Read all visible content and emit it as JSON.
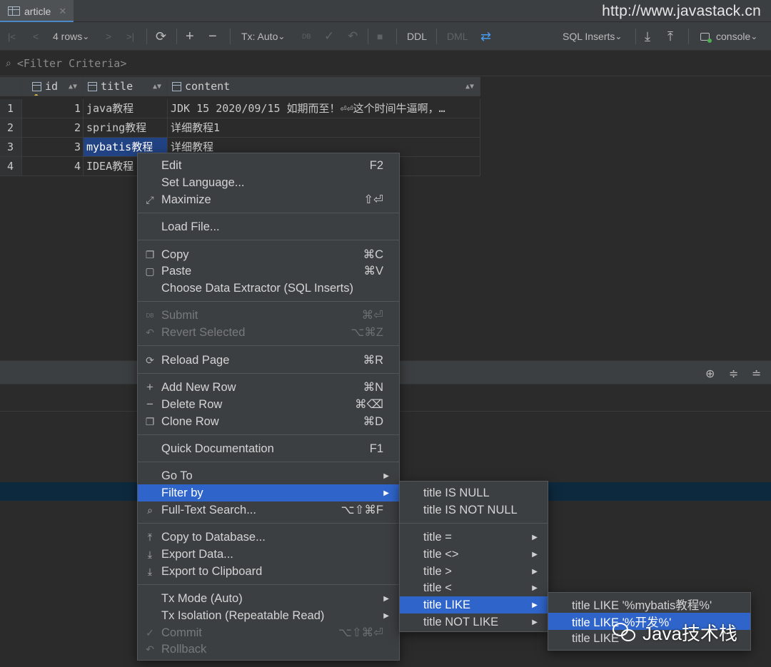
{
  "tab": {
    "label": "article",
    "close": "✕"
  },
  "watermark_url": "http://www.javastack.cn",
  "toolbar": {
    "first": "|<",
    "prev": "<",
    "rows": "4 rows",
    "next": ">",
    "last": ">|",
    "reload": "⟳",
    "add": "+",
    "remove": "−",
    "tx": "Tx: Auto",
    "db": "DB",
    "commit": "✓",
    "revert": "↶",
    "stop": "■",
    "ddl": "DDL",
    "dml": "DML",
    "compare": "⇄",
    "extractor": "SQL Inserts",
    "download": "⤓",
    "upload": "⤒",
    "console": "console"
  },
  "filter": {
    "icon": "⌕",
    "placeholder": "<Filter Criteria>"
  },
  "grid": {
    "headers": {
      "id": "id",
      "title": "title",
      "content": "content"
    },
    "rows": [
      {
        "num": "1",
        "id": "1",
        "title": "java教程",
        "content": "JDK 15 2020/09/15 如期而至！⏎⏎这个时间牛逼啊，…"
      },
      {
        "num": "2",
        "id": "2",
        "title": "spring教程",
        "content": "详细教程1"
      },
      {
        "num": "3",
        "id": "3",
        "title": "mybatis教程",
        "content": "详细教程"
      },
      {
        "num": "4",
        "id": "4",
        "title": "IDEA教程",
        "content": ""
      }
    ]
  },
  "context_menu": {
    "edit": "Edit",
    "edit_sc": "F2",
    "set_language": "Set Language...",
    "maximize": "Maximize",
    "maximize_sc": "⇧⏎",
    "load_file": "Load File...",
    "copy": "Copy",
    "copy_sc": "⌘C",
    "paste": "Paste",
    "paste_sc": "⌘V",
    "choose_extractor": "Choose Data Extractor (SQL Inserts)",
    "submit": "Submit",
    "submit_sc": "⌘⏎",
    "revert_selected": "Revert Selected",
    "revert_sc": "⌥⌘Z",
    "reload_page": "Reload Page",
    "reload_sc": "⌘R",
    "add_row": "Add New Row",
    "add_row_sc": "⌘N",
    "delete_row": "Delete Row",
    "delete_row_sc": "⌘⌫",
    "clone_row": "Clone Row",
    "clone_row_sc": "⌘D",
    "quick_doc": "Quick Documentation",
    "quick_doc_sc": "F1",
    "go_to": "Go To",
    "filter_by": "Filter by",
    "full_text": "Full-Text Search...",
    "full_text_sc": "⌥⇧⌘F",
    "copy_db": "Copy to Database...",
    "export_data": "Export Data...",
    "export_clip": "Export to Clipboard",
    "tx_mode": "Tx Mode (Auto)",
    "tx_iso": "Tx Isolation (Repeatable Read)",
    "commit": "Commit",
    "commit_sc": "⌥⇧⌘⏎",
    "rollback": "Rollback"
  },
  "filter_submenu": {
    "is_null": "title IS NULL",
    "is_not_null": "title IS NOT NULL",
    "eq": "title =",
    "neq": "title <>",
    "gt": "title >",
    "lt": "title <",
    "like": "title LIKE",
    "not_like": "title NOT LIKE"
  },
  "like_submenu": {
    "opt1": "title LIKE '%mybatis教程%'",
    "opt2": "title LIKE '%开发%'",
    "opt3": "title LIKE"
  },
  "wechat_watermark": "Java技术栈"
}
